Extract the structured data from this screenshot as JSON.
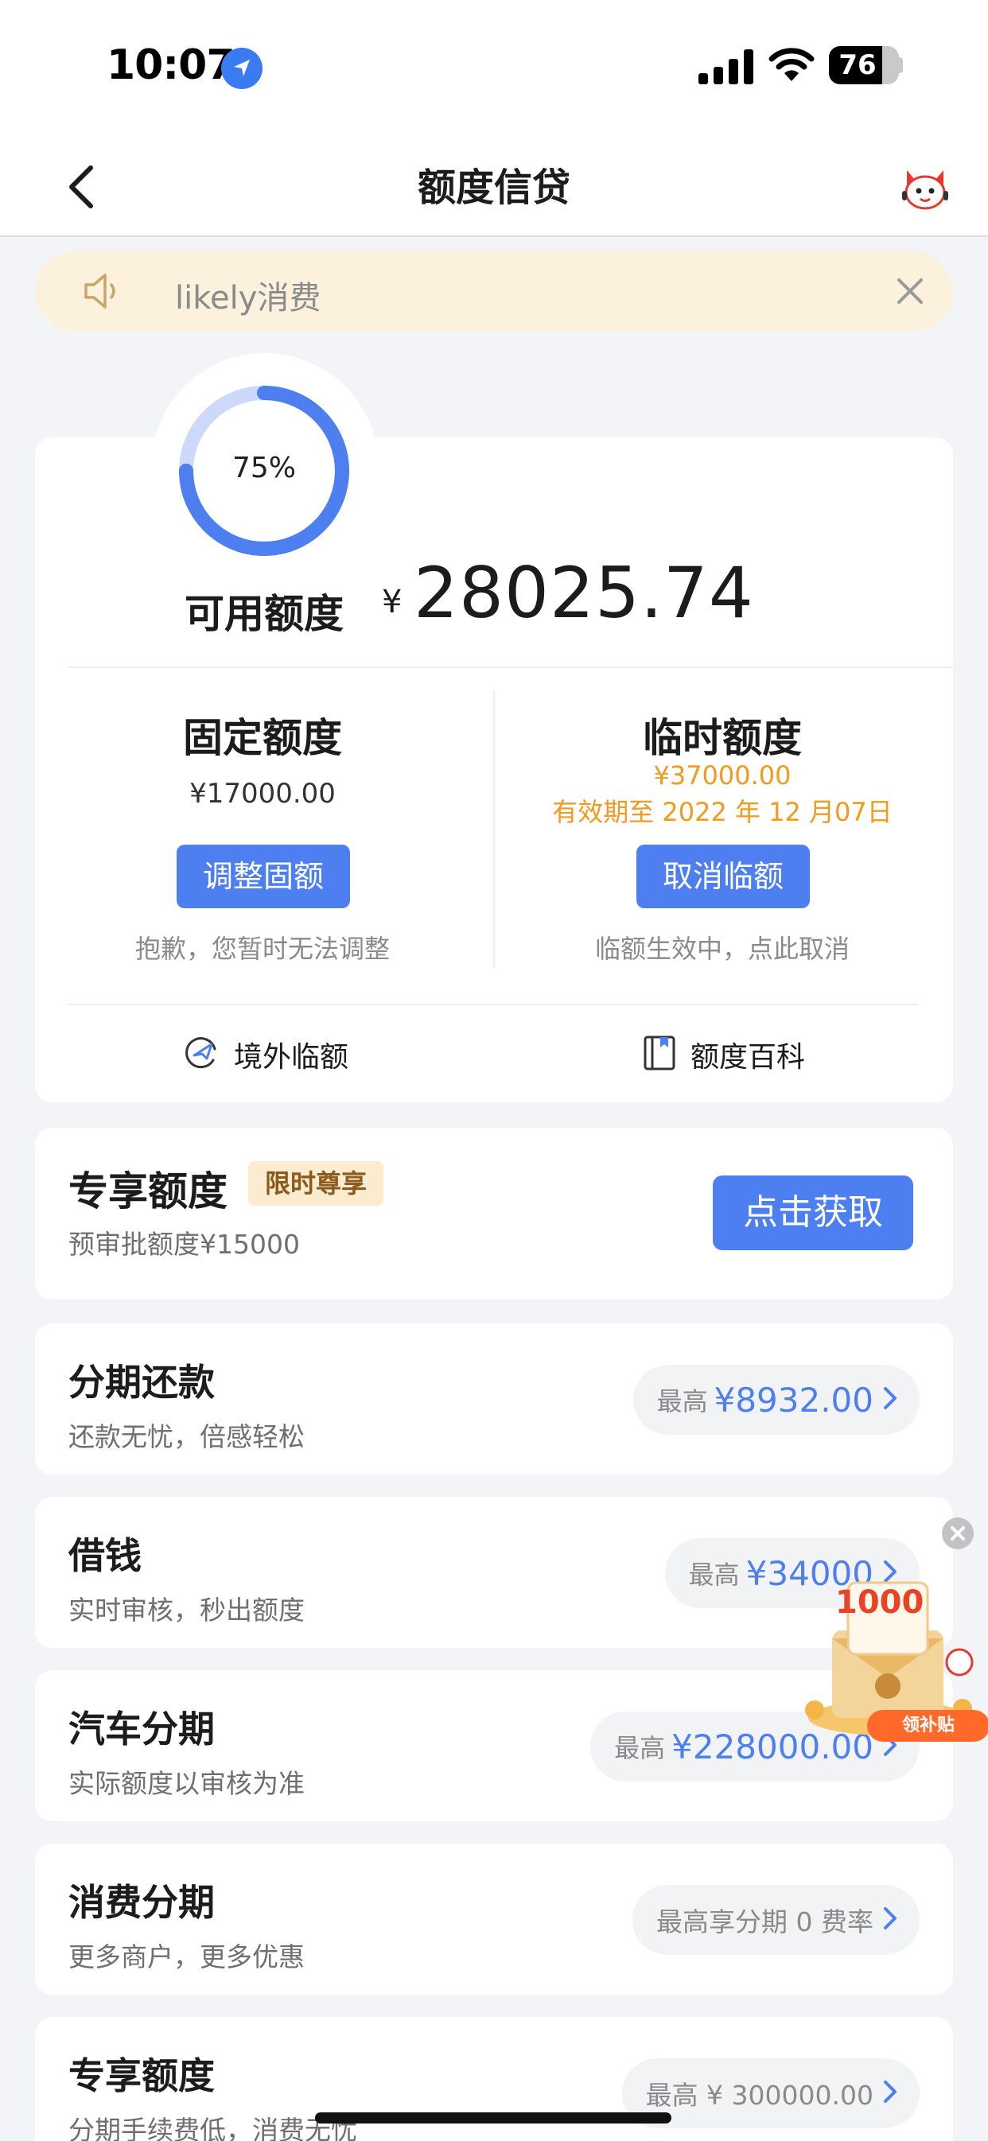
{
  "status_bar": {
    "time": "10:07",
    "battery": "76",
    "battery_level": 0.76
  },
  "nav": {
    "title": "额度信贷"
  },
  "notice": {
    "text": "likely消费"
  },
  "quota": {
    "usage_percent_label": "75%",
    "usage_fraction": 0.75,
    "available_label": "可用额度",
    "currency": "¥",
    "available_amount": "28025.74",
    "fixed": {
      "title": "固定额度",
      "amount": "¥17000.00",
      "button": "调整固额",
      "hint": "抱歉，您暂时无法调整"
    },
    "temporary": {
      "title": "临时额度",
      "amount": "¥37000.00",
      "validity": "有效期至 2022 年 12 月07日",
      "button": "取消临额",
      "hint": "临额生效中，点此取消"
    },
    "links": {
      "overseas": "境外临额",
      "wiki": "额度百科"
    }
  },
  "exclusive": {
    "title": "专享额度",
    "tag": "限时尊享",
    "subtitle": "预审批额度¥15000",
    "button": "点击获取"
  },
  "rows": [
    {
      "title": "分期还款",
      "subtitle": "还款无忧，倍感轻松",
      "prefix": "最高",
      "value": "¥8932.00"
    },
    {
      "title": "借钱",
      "subtitle": "实时审核，秒出额度",
      "prefix": "最高",
      "value": "¥34000"
    },
    {
      "title": "汽车分期",
      "subtitle": "实际额度以审核为准",
      "prefix": "最高",
      "value": "¥228000.00"
    },
    {
      "title": "消费分期",
      "subtitle": "更多商户，更多优惠",
      "text": "最高享分期 0 费率"
    },
    {
      "title": "专享额度",
      "subtitle": "分期手续费低，消费无忧",
      "text": "最高 ¥ 300000.00"
    }
  ],
  "promo": {
    "amount": "1000",
    "button": "领补贴"
  },
  "colors": {
    "accent": "#4e7ff0",
    "orange": "#f39a1d",
    "notice_bg": "#fbf1dc"
  }
}
